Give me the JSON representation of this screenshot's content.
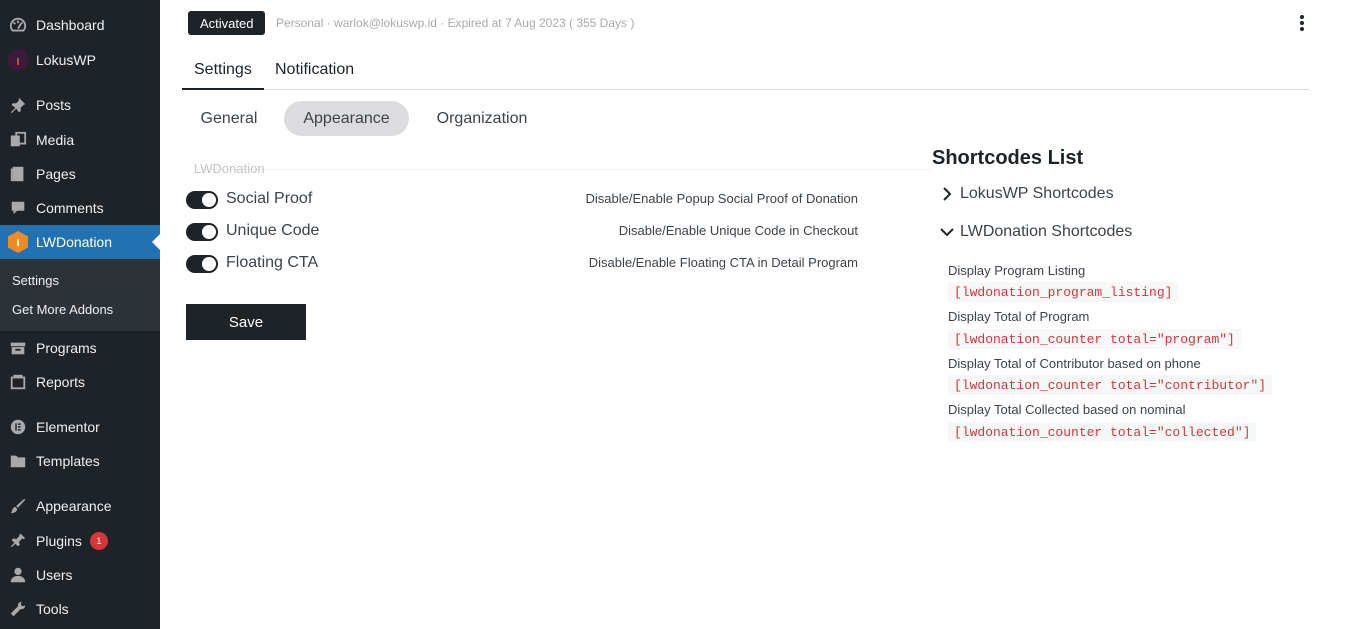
{
  "sidebar": {
    "items": [
      {
        "label": "Dashboard",
        "icon": "dashboard-icon"
      },
      {
        "label": "LokusWP",
        "icon": "lokuswp-logo-icon"
      },
      {
        "label": "Posts",
        "icon": "pushpin-icon"
      },
      {
        "label": "Media",
        "icon": "media-icon"
      },
      {
        "label": "Pages",
        "icon": "pages-icon"
      },
      {
        "label": "Comments",
        "icon": "comment-icon"
      },
      {
        "label": "LWDonation",
        "icon": "lwdonation-logo-icon"
      },
      {
        "label": "Programs",
        "icon": "archive-icon"
      },
      {
        "label": "Reports",
        "icon": "reports-icon"
      },
      {
        "label": "Elementor",
        "icon": "elementor-icon"
      },
      {
        "label": "Templates",
        "icon": "folder-icon"
      },
      {
        "label": "Appearance",
        "icon": "paintbrush-icon"
      },
      {
        "label": "Plugins",
        "icon": "plugin-icon",
        "badge": "1"
      },
      {
        "label": "Users",
        "icon": "user-icon"
      },
      {
        "label": "Tools",
        "icon": "wrench-icon"
      }
    ],
    "submenu": [
      "Settings",
      "Get More Addons"
    ],
    "active_color": "#2271b1",
    "background_color": "#1d2327"
  },
  "header": {
    "status": "Activated",
    "license_info": "Personal · warlok@lokuswp.id · Expired at 7 Aug 2023 ( 355 Days )"
  },
  "tabs": {
    "top": [
      "Settings",
      "Notification"
    ],
    "sub": [
      "General",
      "Appearance",
      "Organization"
    ]
  },
  "section": {
    "title": "LWDonation",
    "toggles": [
      {
        "label": "Social Proof",
        "description": "Disable/Enable Popup Social Proof of Donation",
        "enabled": true
      },
      {
        "label": "Unique Code",
        "description": "Disable/Enable Unique Code in Checkout",
        "enabled": true
      },
      {
        "label": "Floating CTA",
        "description": "Disable/Enable Floating CTA in Detail Program",
        "enabled": true
      }
    ],
    "save_label": "Save"
  },
  "shortcodes": {
    "title": "Shortcodes List",
    "groups": [
      {
        "label": "LokusWP Shortcodes",
        "expanded": false
      },
      {
        "label": "LWDonation Shortcodes",
        "expanded": true
      }
    ],
    "entries": [
      {
        "description": "Display Program Listing",
        "code": "[lwdonation_program_listing]"
      },
      {
        "description": "Display Total of Program",
        "code": "[lwdonation_counter total=\"program\"]"
      },
      {
        "description": "Display Total of Contributor based on phone",
        "code": "[lwdonation_counter total=\"contributor\"]"
      },
      {
        "description": "Display Total Collected based on nominal",
        "code": "[lwdonation_counter total=\"collected\"]"
      }
    ],
    "code_color": "#d63638"
  }
}
